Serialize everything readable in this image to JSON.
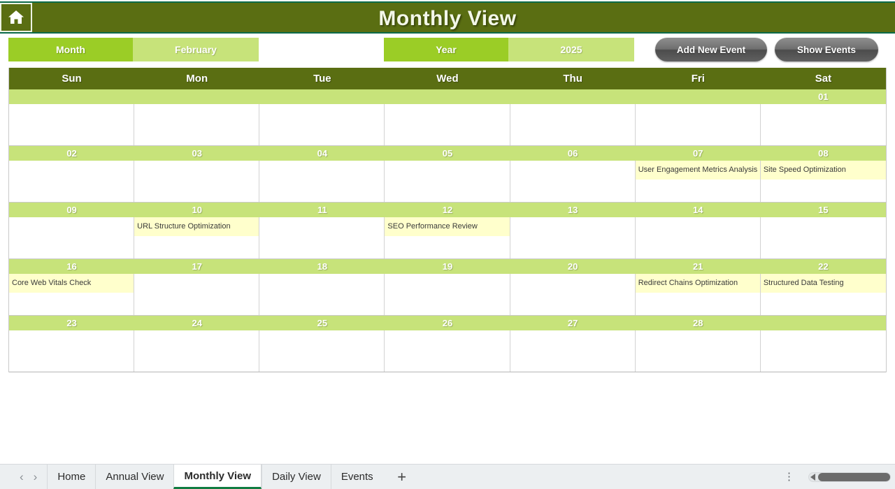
{
  "titlebar": {
    "home_icon": "home-icon",
    "title": "Monthly View"
  },
  "controls": {
    "month_label": "Month",
    "month_value": "February",
    "year_label": "Year",
    "year_value": "2025",
    "add_event_label": "Add New Event",
    "show_events_label": "Show Events"
  },
  "calendar": {
    "weekdays": [
      "Sun",
      "Mon",
      "Tue",
      "Wed",
      "Thu",
      "Fri",
      "Sat"
    ],
    "weeks": [
      {
        "dates": [
          "",
          "",
          "",
          "",
          "",
          "",
          "01"
        ],
        "events": [
          "",
          "",
          "",
          "",
          "",
          "",
          ""
        ]
      },
      {
        "dates": [
          "02",
          "03",
          "04",
          "05",
          "06",
          "07",
          "08"
        ],
        "events": [
          "",
          "",
          "",
          "",
          "",
          "User Engagement Metrics Analysis",
          "Site Speed Optimization"
        ]
      },
      {
        "dates": [
          "09",
          "10",
          "11",
          "12",
          "13",
          "14",
          "15"
        ],
        "events": [
          "",
          "URL Structure Optimization",
          "",
          "SEO Performance Review",
          "",
          "",
          ""
        ]
      },
      {
        "dates": [
          "16",
          "17",
          "18",
          "19",
          "20",
          "21",
          "22"
        ],
        "events": [
          "Core Web Vitals Check",
          "",
          "",
          "",
          "",
          "Redirect Chains Optimization",
          "Structured Data Testing"
        ]
      },
      {
        "dates": [
          "23",
          "24",
          "25",
          "26",
          "27",
          "28",
          ""
        ],
        "events": [
          "",
          "",
          "",
          "",
          "",
          "",
          ""
        ]
      }
    ]
  },
  "sheetbar": {
    "prev_icon": "chevron-left-icon",
    "next_icon": "chevron-right-icon",
    "tabs": [
      {
        "label": "Home",
        "active": false
      },
      {
        "label": "Annual View",
        "active": false
      },
      {
        "label": "Monthly View",
        "active": true
      },
      {
        "label": "Daily View",
        "active": false
      },
      {
        "label": "Events",
        "active": false
      }
    ],
    "add_sheet_label": "+",
    "kebab_icon": "more-vertical-icon",
    "scrollbar_icon": "horizontal-scrollbar"
  },
  "colors": {
    "header_green": "#5a6e12",
    "accent_green": "#9bcd26",
    "light_green": "#c7e37a",
    "event_yellow": "#ffffcc",
    "excel_green": "#107c41",
    "teal_border": "#0c6b4a"
  }
}
